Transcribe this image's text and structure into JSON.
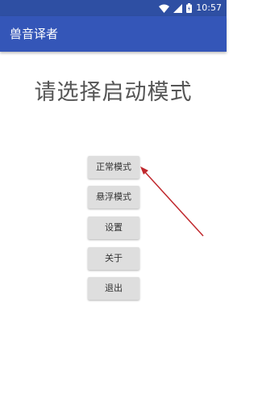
{
  "status_bar": {
    "time": "10:57",
    "icons": [
      "wifi-icon",
      "signal-icon",
      "battery-icon"
    ]
  },
  "app_bar": {
    "title": "兽音译者"
  },
  "main": {
    "headline": "请选择启动模式",
    "buttons": [
      {
        "label": "正常模式"
      },
      {
        "label": "悬浮模式"
      },
      {
        "label": "设置"
      },
      {
        "label": "关于"
      },
      {
        "label": "退出"
      }
    ]
  },
  "colors": {
    "app_bar": "#3456b8",
    "status_bar": "#2e4fa3",
    "arrow": "#c0282d"
  }
}
